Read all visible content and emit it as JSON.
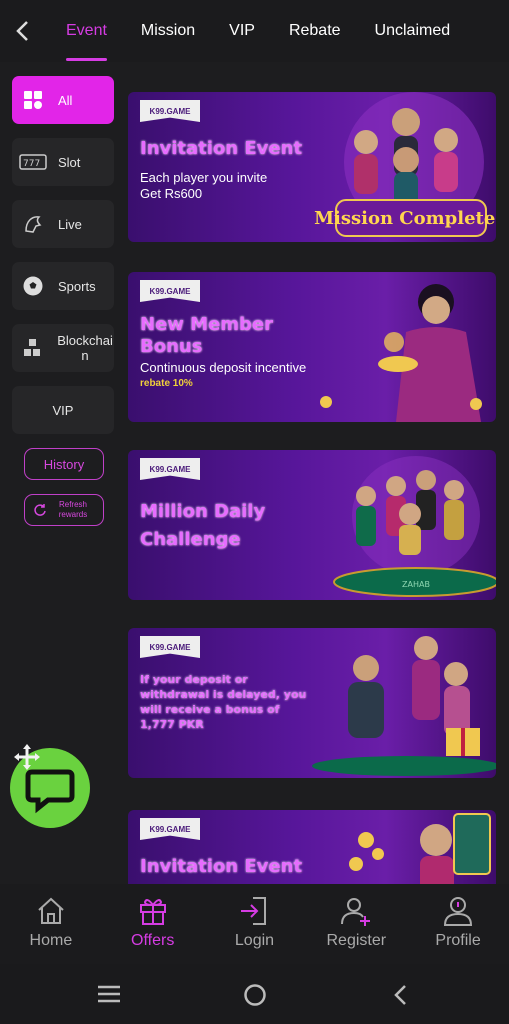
{
  "header": {
    "tabs": [
      {
        "label": "Event",
        "active": true
      },
      {
        "label": "Mission",
        "active": false
      },
      {
        "label": "VIP",
        "active": false
      },
      {
        "label": "Rebate",
        "active": false
      },
      {
        "label": "Unclaimed",
        "active": false
      }
    ]
  },
  "sidebar": {
    "items": [
      {
        "label": "All",
        "icon": "grid-icon",
        "active": true
      },
      {
        "label": "Slot",
        "icon": "slot-icon",
        "active": false
      },
      {
        "label": "Live",
        "icon": "live-dealer-icon",
        "active": false
      },
      {
        "label": "Sports",
        "icon": "soccer-ball-icon",
        "active": false
      },
      {
        "label": "Blockchain",
        "icon": "blockchain-icon",
        "active": false
      },
      {
        "label": "VIP",
        "icon": "",
        "active": false
      }
    ],
    "history_label": "History",
    "refresh_label": "Refresh rewards"
  },
  "banners": [
    {
      "badge": "K99.GAME",
      "title": "Invitation Event",
      "sub1": "Each player you invite",
      "sub2": "Get Rs600",
      "extra": "Mission Completed"
    },
    {
      "badge": "K99.GAME",
      "title": "New Member Bonus",
      "sub1": "Continuous deposit incentive",
      "sub2": "rebate 10%",
      "extra": ""
    },
    {
      "badge": "K99.GAME",
      "title": "Million Daily Challenge",
      "sub1": "",
      "sub2": "",
      "extra": "ZAHAB"
    },
    {
      "badge": "K99.GAME",
      "title": "If your deposit or withdrawal is delayed, you will receive a bonus of 1,777 PKR",
      "sub1": "",
      "sub2": "",
      "extra": ""
    },
    {
      "badge": "K99.GAME",
      "title": "Invitation Event",
      "sub1": "",
      "sub2": "",
      "extra": ""
    }
  ],
  "bottom_nav": [
    {
      "label": "Home",
      "icon": "home-icon",
      "active": false
    },
    {
      "label": "Offers",
      "icon": "gift-icon",
      "active": true
    },
    {
      "label": "Login",
      "icon": "login-icon",
      "active": false
    },
    {
      "label": "Register",
      "icon": "register-icon",
      "active": false
    },
    {
      "label": "Profile",
      "icon": "profile-icon",
      "active": false
    }
  ],
  "colors": {
    "accent": "#d63ce3",
    "background": "#1d1d1f",
    "chat_button": "#6ad23f"
  }
}
